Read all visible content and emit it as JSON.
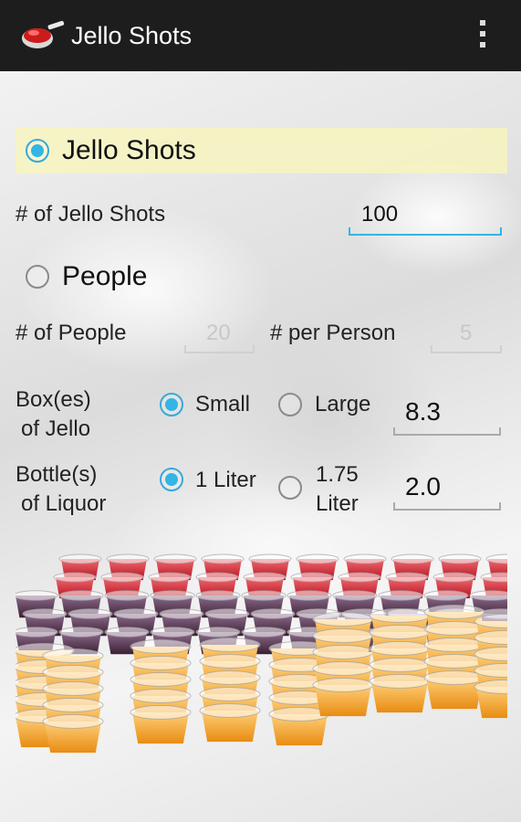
{
  "app": {
    "title": "Jello Shots",
    "icon": "jello-bowl-icon"
  },
  "menu": {
    "icon": "overflow-menu-icon"
  },
  "mode_shots": {
    "label": "Jello Shots",
    "selected": true
  },
  "shots_count": {
    "label": "# of Jello Shots",
    "value": "100"
  },
  "mode_people": {
    "label": "People",
    "selected": false
  },
  "people": {
    "label": "# of People",
    "value": "20"
  },
  "per_person": {
    "label": "# per Person",
    "value": "5"
  },
  "jello": {
    "label_line1": "Box(es)",
    "label_line2": "of Jello",
    "option_small": "Small",
    "option_large": "Large",
    "selected": "Small",
    "value": "8.3"
  },
  "liquor": {
    "label_line1": "Bottle(s)",
    "label_line2": "of Liquor",
    "option_1": "1 Liter",
    "option_2_line1": "1.75",
    "option_2_line2": "Liter",
    "selected": "1 Liter",
    "value": "2.0"
  },
  "colors": {
    "accent": "#33b5e5",
    "actionbar": "#1d1d1d",
    "highlight": "#f8f4be"
  }
}
